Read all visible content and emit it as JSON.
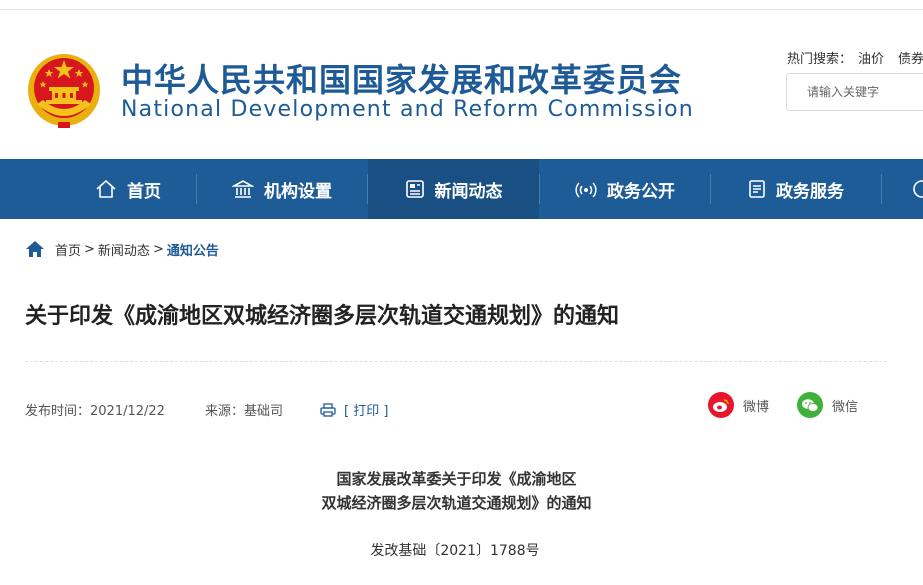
{
  "header": {
    "title_cn": "中华人民共和国国家发展和改革委员会",
    "title_en": "National Development and Reform Commission",
    "hot_search_label": "热门搜索：",
    "hot_keywords": [
      "油价",
      "债券"
    ],
    "search_placeholder": "请输入关键字"
  },
  "nav": {
    "items": [
      {
        "label": "首页",
        "icon": "home-icon"
      },
      {
        "label": "机构设置",
        "icon": "building-icon"
      },
      {
        "label": "新闻动态",
        "icon": "news-icon",
        "active": true
      },
      {
        "label": "政务公开",
        "icon": "broadcast-icon"
      },
      {
        "label": "政务服务",
        "icon": "document-icon"
      }
    ]
  },
  "breadcrumb": {
    "items": [
      "首页",
      "新闻动态",
      "通知公告"
    ],
    "separator": ">"
  },
  "article": {
    "title": "关于印发《成渝地区双城经济圈多层次轨道交通规划》的通知",
    "publish_time": "发布时间：2021/12/22",
    "source": "来源：基础司",
    "print_label": "[ 打印 ]",
    "share": [
      {
        "label": "微博",
        "icon": "weibo-icon",
        "color": "#e6162d"
      },
      {
        "label": "微信",
        "icon": "wechat-icon",
        "color": "#3fb13b"
      }
    ],
    "doc_title_line1": "国家发展改革委关于印发《成渝地区",
    "doc_title_line2": "双城经济圈多层次轨道交通规划》的通知",
    "doc_number": "发改基础〔2021〕1788号"
  },
  "colors": {
    "nav_bg": "#1e5c97",
    "nav_active_bg": "#1a4f83",
    "brand_blue": "#1e5b96",
    "emblem_red": "#d7161e",
    "emblem_gold": "#f5c21b"
  }
}
